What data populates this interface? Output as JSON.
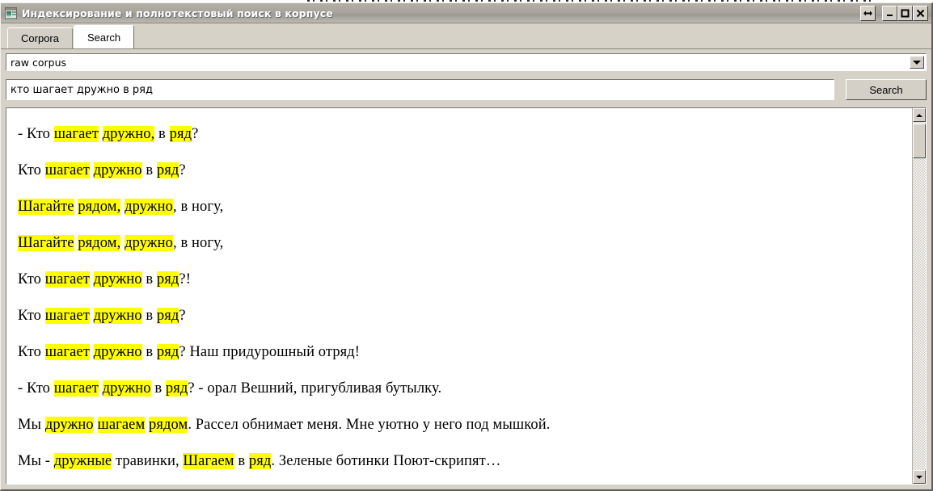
{
  "window": {
    "title": "Индексирование и полнотекстовый поиск в корпусе",
    "app_icon": "window-app-icon",
    "controls": {
      "resize_label": "↔",
      "minimize_label": "_",
      "maximize_label": "□",
      "close_label": "✕"
    }
  },
  "tabs": [
    {
      "label": "Corpora",
      "active": false
    },
    {
      "label": "Search",
      "active": true
    }
  ],
  "corpus_selector": {
    "value": "raw corpus",
    "arrow_icon": "chevron-down-icon"
  },
  "search": {
    "value": "кто шагает дружно в ряд",
    "placeholder": "",
    "button_label": "Search"
  },
  "scrollbar": {
    "up_icon": "triangle-up-icon",
    "down_icon": "triangle-down-icon"
  },
  "results": [
    {
      "id": 1,
      "parts": [
        {
          "t": "- Кто ",
          "hl": false
        },
        {
          "t": "шагает",
          "hl": true
        },
        {
          "t": " ",
          "hl": false
        },
        {
          "t": "дружно,",
          "hl": true
        },
        {
          "t": " в ",
          "hl": false
        },
        {
          "t": "ряд",
          "hl": true
        },
        {
          "t": "?",
          "hl": false
        }
      ]
    },
    {
      "id": 2,
      "parts": [
        {
          "t": "Кто ",
          "hl": false
        },
        {
          "t": "шагает",
          "hl": true
        },
        {
          "t": " ",
          "hl": false
        },
        {
          "t": "дружно",
          "hl": true
        },
        {
          "t": " в ",
          "hl": false
        },
        {
          "t": "ряд",
          "hl": true
        },
        {
          "t": "?",
          "hl": false
        }
      ]
    },
    {
      "id": 3,
      "parts": [
        {
          "t": "Шагайте",
          "hl": true
        },
        {
          "t": " ",
          "hl": false
        },
        {
          "t": "рядом,",
          "hl": true
        },
        {
          "t": " ",
          "hl": false
        },
        {
          "t": "дружно",
          "hl": true
        },
        {
          "t": ", в ногу,",
          "hl": false
        }
      ]
    },
    {
      "id": 4,
      "parts": [
        {
          "t": "Шагайте",
          "hl": true
        },
        {
          "t": " ",
          "hl": false
        },
        {
          "t": "рядом,",
          "hl": true
        },
        {
          "t": " ",
          "hl": false
        },
        {
          "t": "дружно",
          "hl": true
        },
        {
          "t": ", в ногу,",
          "hl": false
        }
      ]
    },
    {
      "id": 5,
      "parts": [
        {
          "t": "Кто ",
          "hl": false
        },
        {
          "t": "шагает",
          "hl": true
        },
        {
          "t": " ",
          "hl": false
        },
        {
          "t": "дружно",
          "hl": true
        },
        {
          "t": " в ",
          "hl": false
        },
        {
          "t": "ряд",
          "hl": true
        },
        {
          "t": "?!",
          "hl": false
        }
      ]
    },
    {
      "id": 6,
      "parts": [
        {
          "t": "Кто ",
          "hl": false
        },
        {
          "t": "шагает",
          "hl": true
        },
        {
          "t": " ",
          "hl": false
        },
        {
          "t": "дружно",
          "hl": true
        },
        {
          "t": " в ",
          "hl": false
        },
        {
          "t": "ряд",
          "hl": true
        },
        {
          "t": "?",
          "hl": false
        }
      ]
    },
    {
      "id": 7,
      "parts": [
        {
          "t": "Кто ",
          "hl": false
        },
        {
          "t": "шагает",
          "hl": true
        },
        {
          "t": " ",
          "hl": false
        },
        {
          "t": "дружно",
          "hl": true
        },
        {
          "t": " в ",
          "hl": false
        },
        {
          "t": "ряд",
          "hl": true
        },
        {
          "t": "? Наш придурошный отряд!",
          "hl": false
        }
      ]
    },
    {
      "id": 8,
      "parts": [
        {
          "t": "- Кто ",
          "hl": false
        },
        {
          "t": "шагает",
          "hl": true
        },
        {
          "t": " ",
          "hl": false
        },
        {
          "t": "дружно",
          "hl": true
        },
        {
          "t": " в ",
          "hl": false
        },
        {
          "t": "ряд",
          "hl": true
        },
        {
          "t": "? - орал Вешний, пригубливая бутылку.",
          "hl": false
        }
      ]
    },
    {
      "id": 9,
      "parts": [
        {
          "t": "Мы ",
          "hl": false
        },
        {
          "t": "дружно",
          "hl": true
        },
        {
          "t": " ",
          "hl": false
        },
        {
          "t": "шагаем",
          "hl": true
        },
        {
          "t": " ",
          "hl": false
        },
        {
          "t": "рядом",
          "hl": true
        },
        {
          "t": ". Рассел обнимает меня. Мне уютно у него под мышкой.",
          "hl": false
        }
      ]
    },
    {
      "id": 10,
      "parts": [
        {
          "t": "Мы - ",
          "hl": false
        },
        {
          "t": "дружные",
          "hl": true
        },
        {
          "t": " травинки, ",
          "hl": false
        },
        {
          "t": "Шагаем",
          "hl": true
        },
        {
          "t": " в ",
          "hl": false
        },
        {
          "t": "ряд",
          "hl": true
        },
        {
          "t": ". Зеленые ботинки Поют-скрипят…",
          "hl": false
        }
      ]
    }
  ],
  "colors": {
    "highlight": "#ffff00",
    "chrome": "#d4d0c8",
    "titlebar_text": "#ffffff"
  }
}
